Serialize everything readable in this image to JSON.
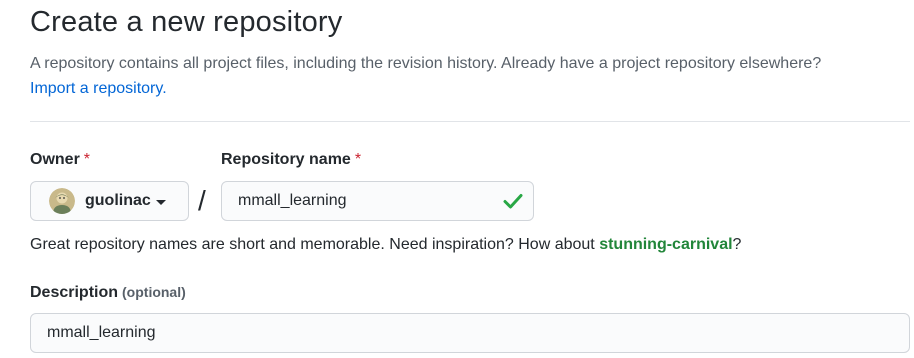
{
  "header": {
    "title": "Create a new repository",
    "subtitle": "A repository contains all project files, including the revision history. Already have a project repository elsewhere?",
    "import_link": "Import a repository."
  },
  "owner": {
    "label": "Owner",
    "required_mark": "*",
    "selected": "guolinac",
    "avatar_icon": "user-avatar"
  },
  "separator": "/",
  "repository": {
    "label": "Repository name",
    "required_mark": "*",
    "value": "mmall_learning",
    "valid_icon": "check-icon",
    "valid_color": "#28a745"
  },
  "hint": {
    "text": "Great repository names are short and memorable. Need inspiration? How about ",
    "suggestion": "stunning-carnival",
    "suffix": "?"
  },
  "description": {
    "label": "Description",
    "optional_note": "(optional)",
    "value": "mmall_learning"
  },
  "colors": {
    "link": "#0366d6",
    "required": "#cb2431",
    "suggestion": "#22863a"
  }
}
